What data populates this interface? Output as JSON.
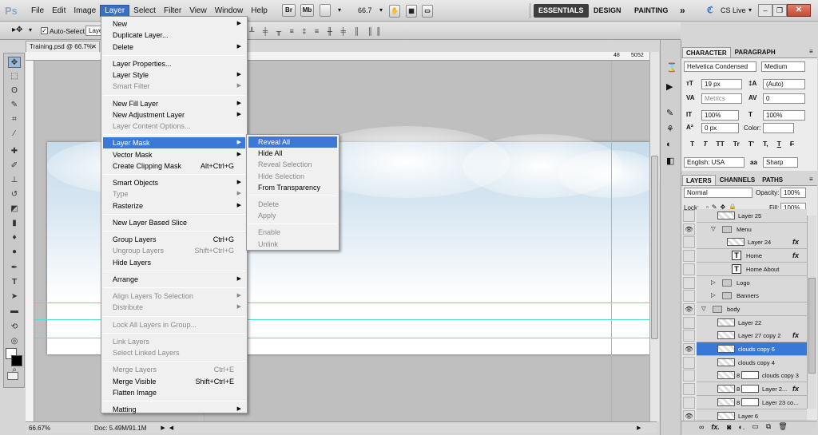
{
  "app": {
    "logo": "Ps"
  },
  "menubar": {
    "menus": [
      "File",
      "Edit",
      "Image",
      "Layer",
      "Select",
      "Filter",
      "View",
      "Window",
      "Help"
    ],
    "active_menu": "Layer",
    "bridge": "Br",
    "minibridge": "Mb",
    "zoom": "66.7",
    "workspaces": [
      "ESSENTIALS",
      "DESIGN",
      "PAINTING"
    ],
    "more": "»",
    "cslive": "CS Live"
  },
  "options": {
    "auto_select_label": "Auto-Select:",
    "auto_select_value": "Layer"
  },
  "document": {
    "tab_title": "Training.psd @ 66.7%",
    "zoom": "66.67%",
    "doc_info": "Doc: 5.49M/91.1M"
  },
  "ruler_numbers": [
    "48",
    "50",
    "52"
  ],
  "layer_menu": {
    "items": [
      {
        "label": "New",
        "sub": true
      },
      {
        "label": "Duplicate Layer..."
      },
      {
        "label": "Delete",
        "sub": true
      },
      {
        "sep": true
      },
      {
        "label": "Layer Properties..."
      },
      {
        "label": "Layer Style",
        "sub": true
      },
      {
        "label": "Smart Filter",
        "sub": true,
        "disabled": true
      },
      {
        "sep": true
      },
      {
        "label": "New Fill Layer",
        "sub": true
      },
      {
        "label": "New Adjustment Layer",
        "sub": true
      },
      {
        "label": "Layer Content Options...",
        "disabled": true
      },
      {
        "sep": true
      },
      {
        "label": "Layer Mask",
        "sub": true,
        "highlight": true
      },
      {
        "label": "Vector Mask",
        "sub": true
      },
      {
        "label": "Create Clipping Mask",
        "shortcut": "Alt+Ctrl+G"
      },
      {
        "sep": true
      },
      {
        "label": "Smart Objects",
        "sub": true
      },
      {
        "label": "Type",
        "sub": true,
        "disabled": true
      },
      {
        "label": "Rasterize",
        "sub": true
      },
      {
        "sep": true
      },
      {
        "label": "New Layer Based Slice"
      },
      {
        "sep": true
      },
      {
        "label": "Group Layers",
        "shortcut": "Ctrl+G"
      },
      {
        "label": "Ungroup Layers",
        "shortcut": "Shift+Ctrl+G",
        "disabled": true
      },
      {
        "label": "Hide Layers"
      },
      {
        "sep": true
      },
      {
        "label": "Arrange",
        "sub": true
      },
      {
        "sep": true
      },
      {
        "label": "Align Layers To Selection",
        "sub": true,
        "disabled": true
      },
      {
        "label": "Distribute",
        "sub": true,
        "disabled": true
      },
      {
        "sep": true
      },
      {
        "label": "Lock All Layers in Group...",
        "disabled": true
      },
      {
        "sep": true
      },
      {
        "label": "Link Layers",
        "disabled": true
      },
      {
        "label": "Select Linked Layers",
        "disabled": true
      },
      {
        "sep": true
      },
      {
        "label": "Merge Layers",
        "shortcut": "Ctrl+E",
        "disabled": true
      },
      {
        "label": "Merge Visible",
        "shortcut": "Shift+Ctrl+E"
      },
      {
        "label": "Flatten Image"
      },
      {
        "sep": true
      },
      {
        "label": "Matting",
        "sub": true
      }
    ]
  },
  "mask_submenu": {
    "items": [
      {
        "label": "Reveal All",
        "highlight": true
      },
      {
        "label": "Hide All"
      },
      {
        "label": "Reveal Selection",
        "disabled": true
      },
      {
        "label": "Hide Selection",
        "disabled": true
      },
      {
        "label": "From Transparency"
      },
      {
        "sep": true
      },
      {
        "label": "Delete",
        "disabled": true
      },
      {
        "label": "Apply",
        "disabled": true
      },
      {
        "sep": true
      },
      {
        "label": "Enable",
        "disabled": true
      },
      {
        "label": "Unlink",
        "disabled": true
      }
    ]
  },
  "character": {
    "tabs": [
      "CHARACTER",
      "PARAGRAPH"
    ],
    "font_family": "Helvetica Condensed",
    "font_style": "Medium",
    "size": "19 px",
    "leading": "(Auto)",
    "kerning": "Metrics",
    "tracking": "0",
    "vscale": "100%",
    "hscale": "100%",
    "baseline": "0 px",
    "color_label": "Color:",
    "style_buttons": [
      "T",
      "T",
      "TT",
      "Tr",
      "T'",
      "T,",
      "T",
      "F"
    ],
    "language": "English: USA",
    "aa_label": "aa",
    "antialias": "Sharp"
  },
  "layers": {
    "tabs": [
      "LAYERS",
      "CHANNELS",
      "PATHS"
    ],
    "blend_mode": "Normal",
    "opacity_label": "Opacity:",
    "opacity": "100%",
    "lock_label": "Lock:",
    "fill_label": "Fill:",
    "fill": "100%",
    "rows": [
      {
        "name": "Layer 25",
        "kind": "layer",
        "indent": 1,
        "eye": false,
        "fx": false
      },
      {
        "name": "Menu",
        "kind": "group",
        "indent": 1,
        "eye": true,
        "open": true
      },
      {
        "name": "Layer 24",
        "kind": "layer",
        "indent": 2,
        "eye": false,
        "fx": true
      },
      {
        "name": "Home",
        "kind": "text",
        "indent": 2,
        "eye": false,
        "fx": true
      },
      {
        "name": "Home      About",
        "kind": "text",
        "indent": 2,
        "eye": false,
        "fx": false
      },
      {
        "name": "Logo",
        "kind": "group",
        "indent": 1,
        "eye": false,
        "open": false
      },
      {
        "name": "Banners",
        "kind": "group",
        "indent": 1,
        "eye": false,
        "open": false
      },
      {
        "name": "body",
        "kind": "group",
        "indent": 0,
        "eye": true,
        "open": true
      },
      {
        "name": "Layer 22",
        "kind": "layer",
        "indent": 1,
        "eye": false
      },
      {
        "name": "Layer 27 copy 2",
        "kind": "layer",
        "indent": 1,
        "eye": false,
        "fx": true
      },
      {
        "name": "clouds copy 6",
        "kind": "layer",
        "indent": 1,
        "eye": true,
        "selected": true
      },
      {
        "name": "clouds copy 4",
        "kind": "layer",
        "indent": 1,
        "eye": false
      },
      {
        "name": "clouds copy 3",
        "kind": "masked",
        "indent": 1,
        "eye": false
      },
      {
        "name": "Layer 2...",
        "kind": "masked",
        "indent": 1,
        "eye": false,
        "fx": true
      },
      {
        "name": "Layer 23 co...",
        "kind": "masked",
        "indent": 1,
        "eye": false
      },
      {
        "name": "Layer 6",
        "kind": "layer",
        "indent": 1,
        "eye": true
      }
    ],
    "footer_icons": [
      "link-icon",
      "fx-icon",
      "mask-icon",
      "adjustment-icon",
      "folder-icon",
      "new-layer-icon",
      "trash-icon"
    ]
  }
}
